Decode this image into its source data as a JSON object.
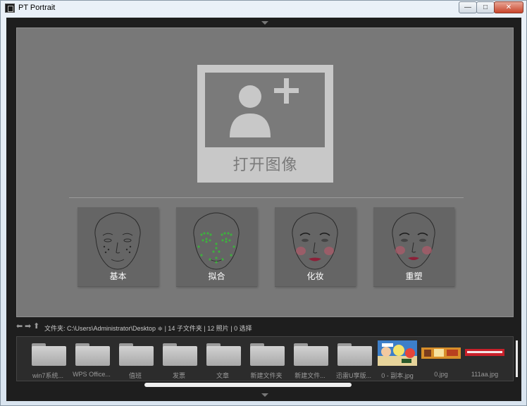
{
  "window": {
    "title": "PT Portrait",
    "buttons": {
      "minimize": "—",
      "maximize": "□",
      "close": "✕"
    }
  },
  "main": {
    "open_label": "打开图像",
    "modes": [
      {
        "label": "基本",
        "icon": "face-basic-icon"
      },
      {
        "label": "拟合",
        "icon": "face-fit-icon"
      },
      {
        "label": "化妆",
        "icon": "face-makeup-icon"
      },
      {
        "label": "重塑",
        "icon": "face-reshape-icon"
      }
    ]
  },
  "pathbar": {
    "text": "文件夹:  C:\\Users\\Administrator\\Desktop ≑ | 14 子文件夹 | 12 照片 | 0 选择"
  },
  "thumbnails": [
    {
      "label": "win7系统...",
      "type": "folder"
    },
    {
      "label": "WPS Office...",
      "type": "folder"
    },
    {
      "label": "值班",
      "type": "folder"
    },
    {
      "label": "发票",
      "type": "folder"
    },
    {
      "label": "文章",
      "type": "folder"
    },
    {
      "label": "新建文件夹",
      "type": "folder"
    },
    {
      "label": "新建文件...",
      "type": "folder"
    },
    {
      "label": "迅雷U享版...",
      "type": "folder"
    },
    {
      "label": "0 - 副本.jpg",
      "type": "image"
    },
    {
      "label": "0.jpg",
      "type": "image"
    },
    {
      "label": "111aa.jpg",
      "type": "image"
    }
  ],
  "colors": {
    "stage": "#787878",
    "card": "#656565",
    "open_button": "#c8c8c8",
    "accent_fit": "#3fae3f",
    "makeup": "#b05a6a"
  }
}
